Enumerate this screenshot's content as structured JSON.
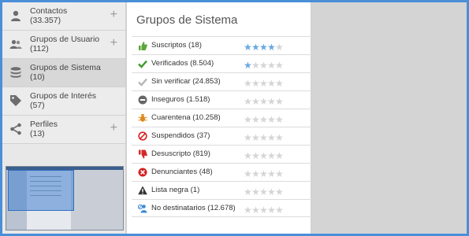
{
  "sidebar": {
    "items": [
      {
        "label": "Contactos",
        "count": "(33.357)",
        "icon": "person-icon",
        "plus": "+"
      },
      {
        "label": "Grupos de Usuario",
        "count": "(112)",
        "icon": "users-icon",
        "plus": "+"
      },
      {
        "label": "Grupos de Sistema",
        "count": "(10)",
        "icon": "database-icon",
        "plus": ""
      },
      {
        "label": "Grupos de Interés",
        "count": "(57)",
        "icon": "tag-icon",
        "plus": ""
      },
      {
        "label": "Perfiles",
        "count": "(13)",
        "icon": "share-icon",
        "plus": "+"
      }
    ]
  },
  "panel": {
    "title": "Grupos de Sistema",
    "rows": [
      {
        "label": "Suscriptos (18)",
        "icon": "thumbs-up-icon",
        "icon_color": "#5aa63a",
        "rating": 4
      },
      {
        "label": "Verificados (8.504)",
        "icon": "check-icon",
        "icon_color": "#3c9a2a",
        "rating": 1
      },
      {
        "label": "Sin verificar (24.853)",
        "icon": "check-icon",
        "icon_color": "#b5b5b5",
        "rating": 0
      },
      {
        "label": "Inseguros (1.518)",
        "icon": "minus-circle-icon",
        "icon_color": "#666666",
        "rating": 0
      },
      {
        "label": "Cuarentena (10.258)",
        "icon": "bug-icon",
        "icon_color": "#e08a1e",
        "rating": 0
      },
      {
        "label": "Suspendidos (37)",
        "icon": "forbidden-icon",
        "icon_color": "#d42020",
        "rating": 0
      },
      {
        "label": "Desuscripto (819)",
        "icon": "thumbs-down-icon",
        "icon_color": "#d42a2a",
        "rating": 0
      },
      {
        "label": "Denunciantes (48)",
        "icon": "x-circle-icon",
        "icon_color": "#d42020",
        "rating": 0
      },
      {
        "label": "Lista negra (1)",
        "icon": "warning-icon",
        "icon_color": "#333333",
        "rating": 0
      },
      {
        "label": "No destinatarios (12.678)",
        "icon": "user-blocked-icon",
        "icon_color": "#3d8bd4",
        "rating": 0
      }
    ],
    "max_rating": 5
  },
  "colors": {
    "star_on": "#6aa9e0",
    "star_off": "#d5d5d5",
    "frame": "#4a8fd8"
  }
}
